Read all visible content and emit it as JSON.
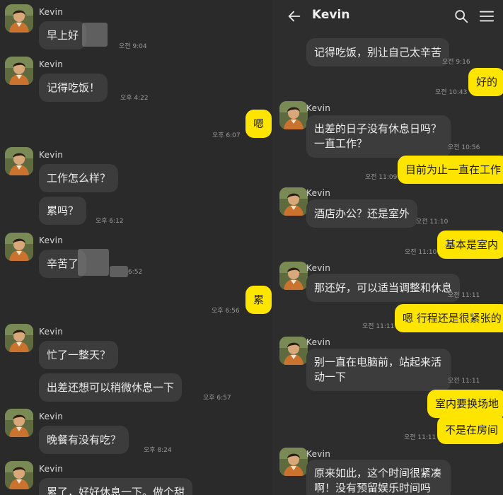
{
  "header": {
    "title": "Kevin"
  },
  "left": {
    "contact": "Kevin",
    "g1": {
      "msg1": "早上好",
      "t1": "오전 9:04"
    },
    "g2": {
      "msg1": "记得吃饭！",
      "t1": "오후 4:22"
    },
    "me1": {
      "msg": "嗯",
      "t": "오후 6:07"
    },
    "g3": {
      "msg1": "工作怎么样？",
      "msg2": "累吗？",
      "t2": "오후 6:12"
    },
    "g4": {
      "msg1": "辛苦了",
      "t1": "6:52"
    },
    "me2": {
      "msg": "累",
      "t": "오후 6:56"
    },
    "g5": {
      "msg1": "忙了一整天？",
      "msg2": "出差还想可以稍微休息一下",
      "t2": "오후 6:57"
    },
    "g6": {
      "msg1": "晚餐有没有吃？",
      "t1": "오후 8:24"
    },
    "g7": {
      "msg1": "累了，好好休息一下。做个甜"
    }
  },
  "right": {
    "contact": "Kevin",
    "r0": {
      "msg": "记得吃饭，别让自己太辛苦",
      "t": "오전 9:16"
    },
    "m1": {
      "msg": "好的",
      "t": "오전 10:43"
    },
    "r1": {
      "msg": "出差的日子没有休息日吗？一直工作？",
      "t": "오전 10:56"
    },
    "m2": {
      "msg": "目前为止一直在工作",
      "t": "오전 11:09"
    },
    "r2": {
      "msg": "酒店办公？还是室外",
      "t": "오전 11:10"
    },
    "m3": {
      "msg": "基本是室内",
      "t": "오전 11:10"
    },
    "r3": {
      "msg": "那还好，可以适当调整和休息",
      "t": "오전 11:11"
    },
    "m4": {
      "msg": "嗯 行程还是很紧张的",
      "t": "오전 11:11"
    },
    "r4": {
      "msg": "别一直在电脑前，站起来活动一下",
      "t": "오전 11:11"
    },
    "m5": {
      "msg1": "室内要换场地",
      "msg2": "不是在房间",
      "t": "오전 11:11"
    },
    "r5": {
      "msg": "原来如此，这个时间很紧凑啊！没有预留娱乐时间吗"
    }
  },
  "icons": {
    "back": "arrow-left-icon",
    "search": "search-icon",
    "menu": "hamburger-menu-icon"
  },
  "colors": {
    "my_bubble": "#fee500",
    "their_bubble": "#3c3c3c",
    "background": "#2b2b2b"
  }
}
